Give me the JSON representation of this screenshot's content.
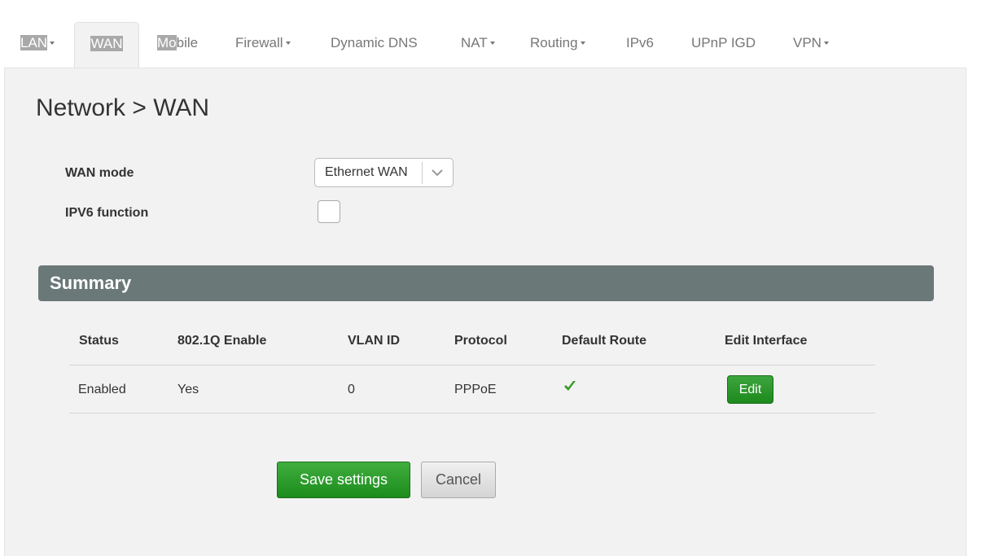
{
  "tabs": [
    {
      "label": "LAN",
      "has_menu": true
    },
    {
      "label": "WAN",
      "has_menu": false,
      "active": true
    },
    {
      "label_a": "Mo",
      "label_b": "bile",
      "label": "Mobile",
      "has_menu": false
    },
    {
      "label": "Firewall",
      "has_menu": true
    },
    {
      "label": "Dynamic DNS",
      "has_menu": false
    },
    {
      "label": "NAT",
      "has_menu": true
    },
    {
      "label": "Routing",
      "has_menu": true
    },
    {
      "label": "IPv6",
      "has_menu": false
    },
    {
      "label": "UPnP IGD",
      "has_menu": false
    },
    {
      "label": "VPN",
      "has_menu": true
    }
  ],
  "page": {
    "title": "Network > WAN"
  },
  "form": {
    "wan_mode_label": "WAN mode",
    "wan_mode_value": "Ethernet WAN",
    "ipv6_label": "IPV6 function",
    "ipv6_checked": false
  },
  "summary": {
    "title": "Summary",
    "columns": [
      "Status",
      "802.1Q Enable",
      "VLAN ID",
      "Protocol",
      "Default Route",
      "Edit Interface"
    ],
    "rows": [
      {
        "status": "Enabled",
        "vlan_enable": "Yes",
        "vlan_id": "0",
        "protocol": "PPPoE",
        "default_route": "check-icon",
        "edit_label": "Edit"
      }
    ]
  },
  "actions": {
    "save_label": "Save settings",
    "cancel_label": "Cancel"
  },
  "colors": {
    "accent_green": "#2a9a2a",
    "summary_bar": "#6b7878",
    "panel_bg": "#f2f2f2"
  }
}
